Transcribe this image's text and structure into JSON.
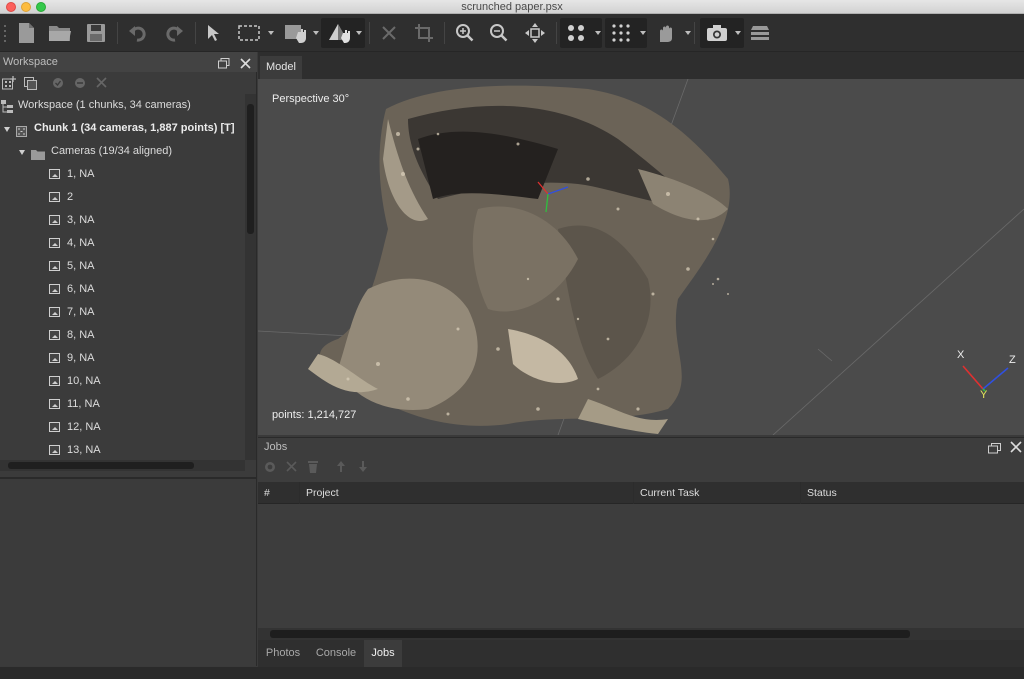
{
  "window": {
    "title": "scrunched paper.psx"
  },
  "workspace": {
    "title": "Workspace",
    "root_label": "Workspace (1 chunks, 34 cameras)",
    "chunk_label": "Chunk 1 (34 cameras, 1,887 points) [T]",
    "cameras_label": "Cameras (19/34 aligned)",
    "cameras": [
      "1, NA",
      "2",
      "3, NA",
      "4, NA",
      "5, NA",
      "6, NA",
      "7, NA",
      "8, NA",
      "9, NA",
      "10, NA",
      "11, NA",
      "12, NA",
      "13, NA"
    ]
  },
  "model": {
    "tab_label": "Model",
    "projection": "Perspective 30°",
    "points": "points: 1,214,727",
    "axes": {
      "x": "X",
      "y": "Y",
      "z": "Z"
    }
  },
  "jobs": {
    "title": "Jobs",
    "columns": [
      "#",
      "Project",
      "Current Task",
      "Status"
    ]
  },
  "bottom_tabs": [
    {
      "label": "Photos",
      "active": false
    },
    {
      "label": "Console",
      "active": false
    },
    {
      "label": "Jobs",
      "active": true
    }
  ],
  "colors": {
    "accent_red": "#fc605c",
    "axis_x": "#e03030",
    "axis_y": "#2fbf3f",
    "axis_z": "#3050e0"
  }
}
